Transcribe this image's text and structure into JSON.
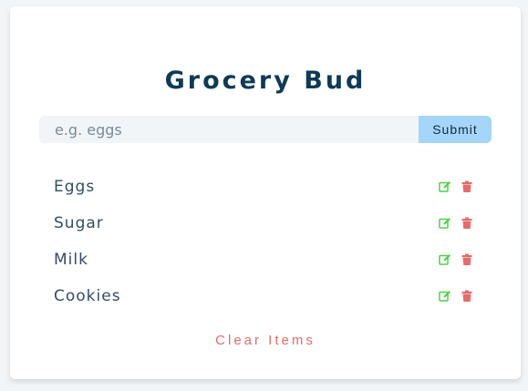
{
  "app": {
    "title": "Grocery Bud"
  },
  "form": {
    "placeholder": "e.g. eggs",
    "submit_label": "Submit"
  },
  "items": [
    {
      "label": "Eggs"
    },
    {
      "label": "Sugar"
    },
    {
      "label": "Milk"
    },
    {
      "label": "Cookies"
    }
  ],
  "footer": {
    "clear_label": "Clear Items"
  },
  "colors": {
    "title": "#0f3a57",
    "submit_bg": "#a5d5f8",
    "edit_icon": "#4cd04a",
    "delete_icon": "#e66b6b",
    "clear_text": "#e66b6b"
  }
}
